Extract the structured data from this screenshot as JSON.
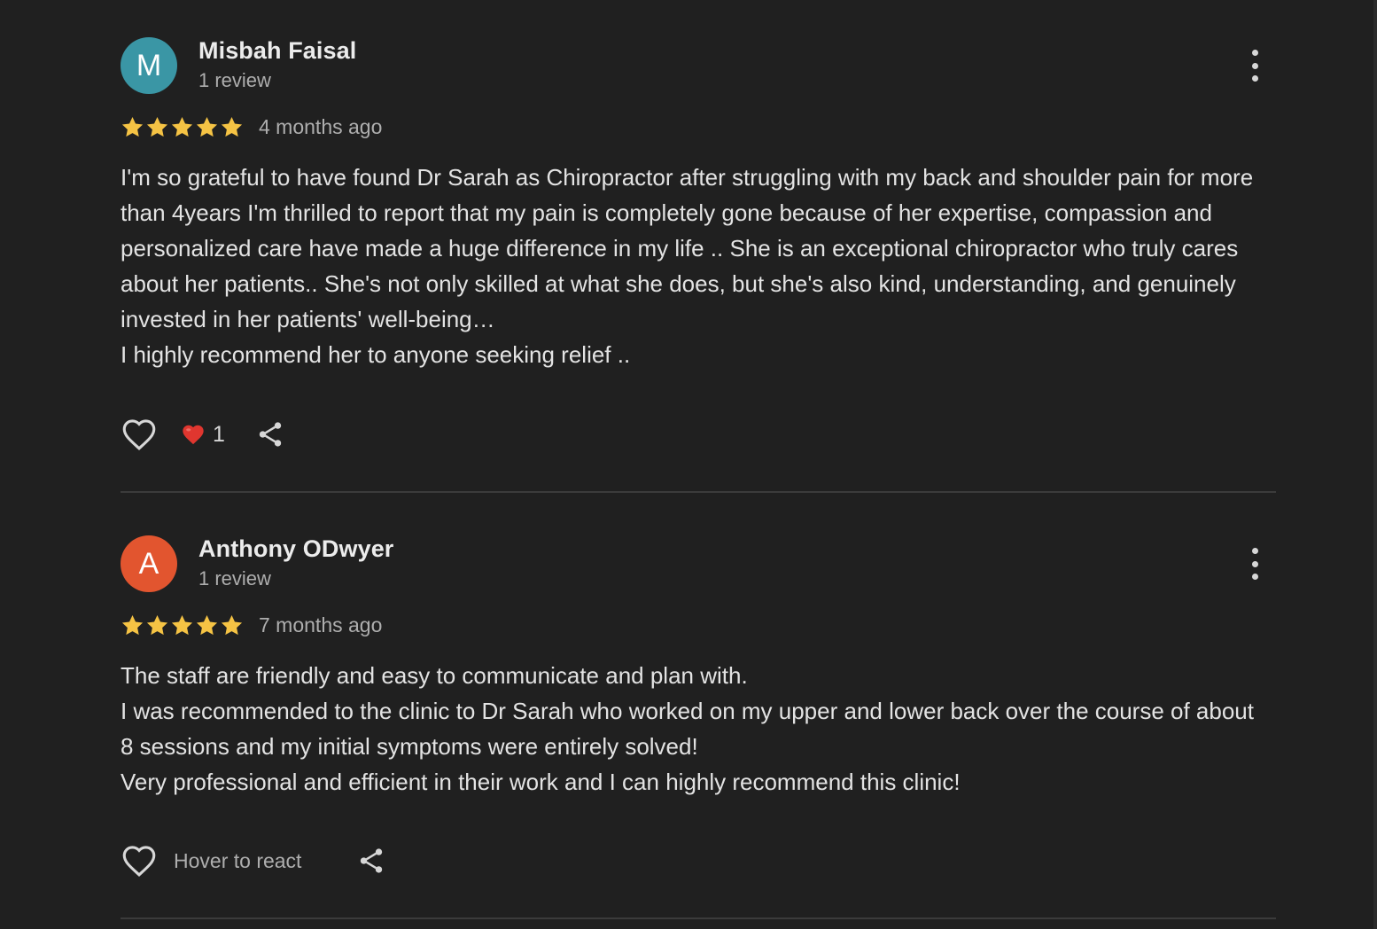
{
  "reviews": [
    {
      "author": "Misbah Faisal",
      "initial": "M",
      "avatar_color": "#3a96a5",
      "meta": "1 review",
      "rating": 5,
      "date": "4 months ago",
      "text": "I'm so grateful to have found Dr Sarah as Chiropractor after struggling with my back and shoulder pain for more than 4years I'm thrilled to report that my pain is completely gone because of her expertise, compassion and personalized care have made a huge difference in my life .. She is an exceptional chiropractor who truly cares about her patients.. She's not only skilled at what she does, but she's also kind, understanding, and genuinely invested in her patients' well-being…\nI highly recommend her to anyone seeking relief ..",
      "reaction": {
        "icon": "heart-emoji",
        "count": "1"
      }
    },
    {
      "author": "Anthony ODwyer",
      "initial": "A",
      "avatar_color": "#e2552f",
      "meta": "1 review",
      "rating": 5,
      "date": "7 months ago",
      "text": "The staff are friendly and easy to communicate and plan with.\nI was recommended to the clinic to Dr Sarah who worked on my upper and lower back over the course of about 8 sessions and my initial symptoms were entirely solved!\nVery professional and efficient in their work and I can highly recommend this clinic!",
      "hover_hint": "Hover to react"
    }
  ],
  "colors": {
    "background": "#202020",
    "star": "#f5c344",
    "divider": "#3b3b3b",
    "icon": "#d7d7d7",
    "heart": "#e0362f"
  }
}
